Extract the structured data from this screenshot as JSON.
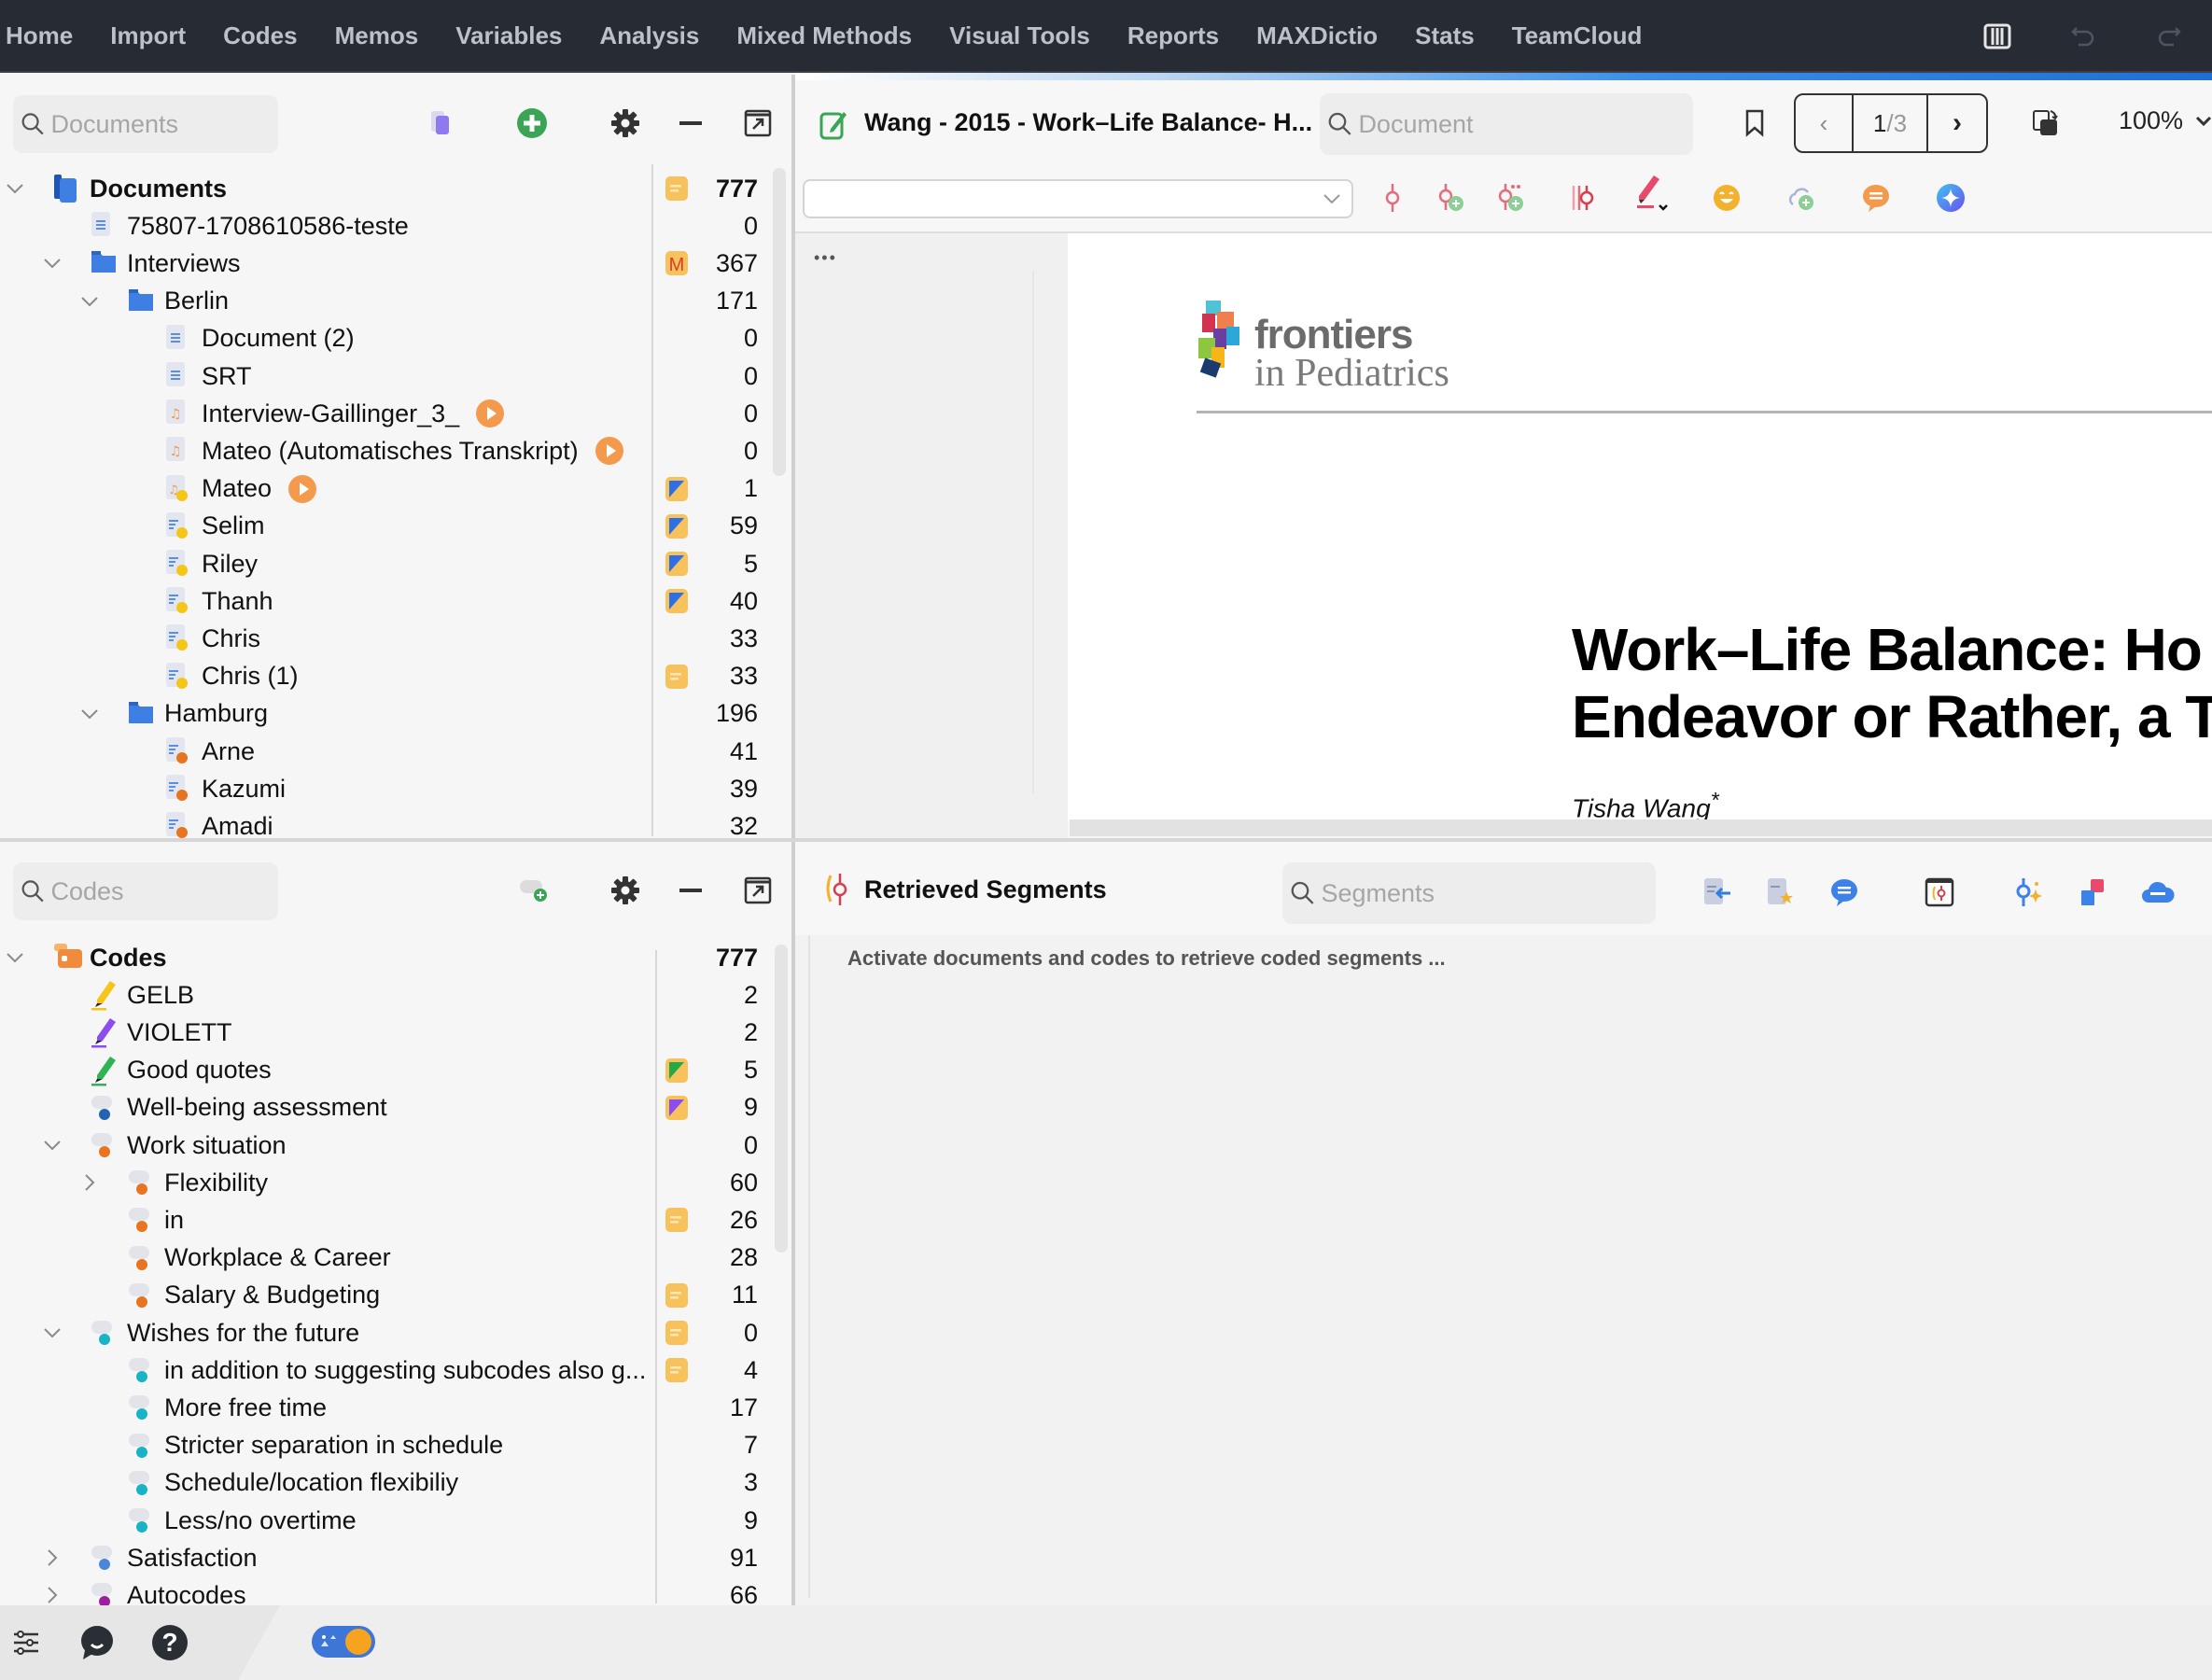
{
  "menubar": {
    "items": [
      "Home",
      "Import",
      "Codes",
      "Memos",
      "Variables",
      "Analysis",
      "Mixed Methods",
      "Visual Tools",
      "Reports",
      "MAXDictio",
      "Stats",
      "TeamCloud"
    ],
    "right_icons": [
      "layout-icon",
      "undo-icon",
      "redo-icon"
    ]
  },
  "documents_panel": {
    "search_placeholder": "Documents",
    "toolbar_icons": [
      "document-set-icon",
      "add-icon",
      "gear-icon",
      "minimize-icon",
      "undock-icon"
    ],
    "tree": [
      {
        "label": "Documents",
        "count": "777",
        "level": 0,
        "expanded": true,
        "icon": "documents-root-icon",
        "memo": "memo-note",
        "bold": true
      },
      {
        "label": "75807-1708610586-teste",
        "count": "0",
        "level": 1,
        "icon": "text-doc-icon"
      },
      {
        "label": "Interviews",
        "count": "367",
        "level": 1,
        "expanded": true,
        "icon": "folder-icon",
        "memo": "memo-M"
      },
      {
        "label": "Berlin",
        "count": "171",
        "level": 2,
        "expanded": true,
        "icon": "folder-icon"
      },
      {
        "label": "Document (2)",
        "count": "0",
        "level": 3,
        "icon": "text-doc-icon"
      },
      {
        "label": "SRT",
        "count": "0",
        "level": 3,
        "icon": "text-doc-icon"
      },
      {
        "label": "Interview-Gaillinger_3_",
        "count": "0",
        "level": 3,
        "icon": "audio-doc-icon",
        "media": true
      },
      {
        "label": "Mateo (Automatisches Transkript)",
        "count": "0",
        "level": 3,
        "icon": "audio-doc-icon",
        "media": true
      },
      {
        "label": "Mateo",
        "count": "1",
        "level": 3,
        "icon": "audio-doc-yellow-icon",
        "media": true,
        "memo": "memo-blue"
      },
      {
        "label": "Selim",
        "count": "59",
        "level": 3,
        "icon": "transcript-yellow-icon",
        "memo": "memo-blue"
      },
      {
        "label": "Riley",
        "count": "5",
        "level": 3,
        "icon": "transcript-yellow-icon",
        "memo": "memo-blue"
      },
      {
        "label": "Thanh",
        "count": "40",
        "level": 3,
        "icon": "transcript-yellow-icon",
        "memo": "memo-blue"
      },
      {
        "label": "Chris",
        "count": "33",
        "level": 3,
        "icon": "transcript-yellow-icon"
      },
      {
        "label": "Chris (1)",
        "count": "33",
        "level": 3,
        "icon": "transcript-yellow-icon",
        "memo": "memo-note"
      },
      {
        "label": "Hamburg",
        "count": "196",
        "level": 2,
        "expanded": true,
        "icon": "folder-icon"
      },
      {
        "label": "Arne",
        "count": "41",
        "level": 3,
        "icon": "transcript-orange-icon"
      },
      {
        "label": "Kazumi",
        "count": "39",
        "level": 3,
        "icon": "transcript-orange-icon"
      },
      {
        "label": "Amadi",
        "count": "32",
        "level": 3,
        "icon": "transcript-orange-icon"
      }
    ]
  },
  "codes_panel": {
    "search_placeholder": "Codes",
    "toolbar_icons": [
      "new-code-icon",
      "gear-icon",
      "minimize-icon",
      "undock-icon"
    ],
    "tree": [
      {
        "label": "Codes",
        "count": "777",
        "level": 0,
        "expanded": true,
        "icon": "code-system-icon",
        "bold": true
      },
      {
        "label": "GELB",
        "count": "2",
        "level": 1,
        "icon": "highlighter-yellow-icon"
      },
      {
        "label": "VIOLETT",
        "count": "2",
        "level": 1,
        "icon": "highlighter-purple-icon"
      },
      {
        "label": "Good quotes",
        "count": "5",
        "level": 1,
        "icon": "highlighter-green-icon",
        "memo": "memo-green"
      },
      {
        "label": "Well-being assessment",
        "count": "9",
        "level": 1,
        "icon": "code-navy-icon",
        "memo": "memo-purple"
      },
      {
        "label": "Work situation",
        "count": "0",
        "level": 1,
        "expanded": true,
        "icon": "code-orange-icon"
      },
      {
        "label": "Flexibility",
        "count": "60",
        "level": 2,
        "collapsed": true,
        "icon": "code-orange-icon"
      },
      {
        "label": "in",
        "count": "26",
        "level": 2,
        "icon": "code-orange-icon",
        "memo": "memo-note"
      },
      {
        "label": "Workplace & Career",
        "count": "28",
        "level": 2,
        "icon": "code-orange-icon"
      },
      {
        "label": "Salary & Budgeting",
        "count": "11",
        "level": 2,
        "icon": "code-orange-icon",
        "memo": "memo-note"
      },
      {
        "label": "Wishes for the future",
        "count": "0",
        "level": 1,
        "expanded": true,
        "icon": "code-teal-icon",
        "memo": "memo-note"
      },
      {
        "label": "in addition to suggesting subcodes also g...",
        "count": "4",
        "level": 2,
        "icon": "code-teal-icon",
        "memo": "memo-note"
      },
      {
        "label": "More free time",
        "count": "17",
        "level": 2,
        "icon": "code-teal-icon"
      },
      {
        "label": "Stricter separation in schedule",
        "count": "7",
        "level": 2,
        "icon": "code-teal-icon"
      },
      {
        "label": "Schedule/location flexibiliy",
        "count": "3",
        "level": 2,
        "icon": "code-teal-icon"
      },
      {
        "label": "Less/no overtime",
        "count": "9",
        "level": 2,
        "icon": "code-teal-icon"
      },
      {
        "label": "Satisfaction",
        "count": "91",
        "level": 1,
        "collapsed": true,
        "icon": "code-blue-icon"
      },
      {
        "label": "Autocodes",
        "count": "66",
        "level": 1,
        "collapsed": true,
        "icon": "code-magenta-icon"
      }
    ]
  },
  "document_browser": {
    "title": "Wang - 2015 - Work–Life Balance- H...",
    "search_placeholder": "Document",
    "page_current": "1",
    "page_total": "3",
    "page_separator": "/",
    "zoom": "100%",
    "code_dropdown_value": "",
    "more_label": "•••",
    "coding_toolbar_icons": [
      "code-icon",
      "code-with-new-code-icon",
      "code-with-new-code-in-vivo-icon",
      "uncode-icon",
      "highlighter-icon",
      "emoticode-icon",
      "new-memo-cloud-icon",
      "comment-icon",
      "ai-assist-icon"
    ],
    "page": {
      "journal_brand": "frontiers",
      "journal_sub": "in Pediatrics",
      "title_line1": "Work–Life Balance: Ho",
      "title_line2": "Endeavor or Rather, a T",
      "author": "Tisha Wang",
      "author_mark": "*"
    }
  },
  "retrieved_segments": {
    "title": "Retrieved Segments",
    "search_placeholder": "Segments",
    "empty_message": "Activate documents and codes to retrieve coded segments ...",
    "toolbar_icons": [
      "export-segments-icon",
      "favorite-segments-icon",
      "comment-icon",
      "smart-coding-icon",
      "ai-code-icon",
      "overview-icon",
      "teamcloud-icon"
    ]
  },
  "footer": {
    "icons": [
      "settings-sliders-icon",
      "chat-icon",
      "help-icon",
      "theme-toggle-icon"
    ]
  },
  "colors": {
    "menubar_bg": "#272b33",
    "accent_blue": "#1f6fd3",
    "folder_blue": "#3f7ee3",
    "memo_yellow": "#f7c15c",
    "media_orange": "#f39a4c",
    "code_orange": "#e8741f",
    "code_teal": "#18b3c5",
    "code_navy": "#2463b0"
  }
}
